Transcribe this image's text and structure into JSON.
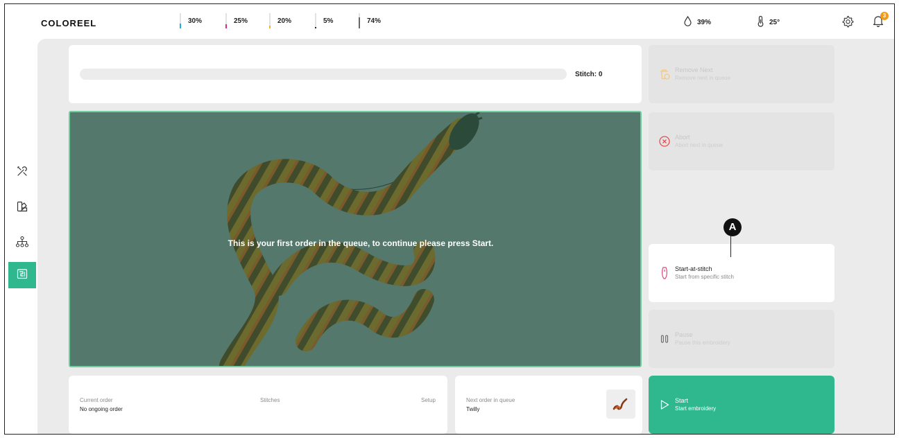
{
  "header": {
    "logo": "COLOREEL",
    "levels": [
      {
        "value": "30%",
        "fraction": 0.3,
        "color": "#2aa9d8"
      },
      {
        "value": "25%",
        "fraction": 0.25,
        "color": "#e0248a"
      },
      {
        "value": "20%",
        "fraction": 0.2,
        "color": "#f2b230"
      },
      {
        "value": "5%",
        "fraction": 0.05,
        "color": "#222222"
      },
      {
        "value": "74%",
        "fraction": 0.74,
        "color": "#666666"
      }
    ],
    "humidity": {
      "icon": "droplet-icon",
      "value": "39%"
    },
    "temperature": {
      "icon": "thermometer-icon",
      "value": "25°"
    },
    "settings_icon": "gear-icon",
    "notifications": {
      "icon": "bell-icon",
      "count": "3"
    }
  },
  "sidebar": {
    "items": [
      {
        "icon": "tools-icon",
        "active": false
      },
      {
        "icon": "palette-icon",
        "active": false
      },
      {
        "icon": "network-icon",
        "active": false
      },
      {
        "icon": "machine-icon",
        "active": true
      }
    ]
  },
  "progress": {
    "stitch_label": "Stitch: 0",
    "fraction": 0
  },
  "preview": {
    "message": "This is your first order in the queue, to continue please press Start."
  },
  "current_order": {
    "heading": "Current order",
    "value": "No ongoing order",
    "stitches_heading": "Stitches",
    "setup_heading": "Setup"
  },
  "next_order": {
    "heading": "Next order in queue",
    "value": "Twilly"
  },
  "actions": {
    "remove_next": {
      "title": "Remove Next",
      "subtitle": "Remove next in queue",
      "enabled": false
    },
    "abort": {
      "title": "Abort",
      "subtitle": "Abort next in queue",
      "enabled": false
    },
    "start_at_stitch": {
      "title": "Start-at-stitch",
      "subtitle": "Start from specific stitch",
      "enabled": true
    },
    "pause": {
      "title": "Pause",
      "subtitle": "Pause this embroidery",
      "enabled": false
    },
    "start": {
      "title": "Start",
      "subtitle": "Start embroidery",
      "enabled": true
    }
  },
  "callout": {
    "label": "A"
  },
  "colors": {
    "accent": "#2fb88e",
    "preview_bg": "#54786c",
    "orange": "#f39a1a",
    "abort_red": "#e84d4d"
  }
}
